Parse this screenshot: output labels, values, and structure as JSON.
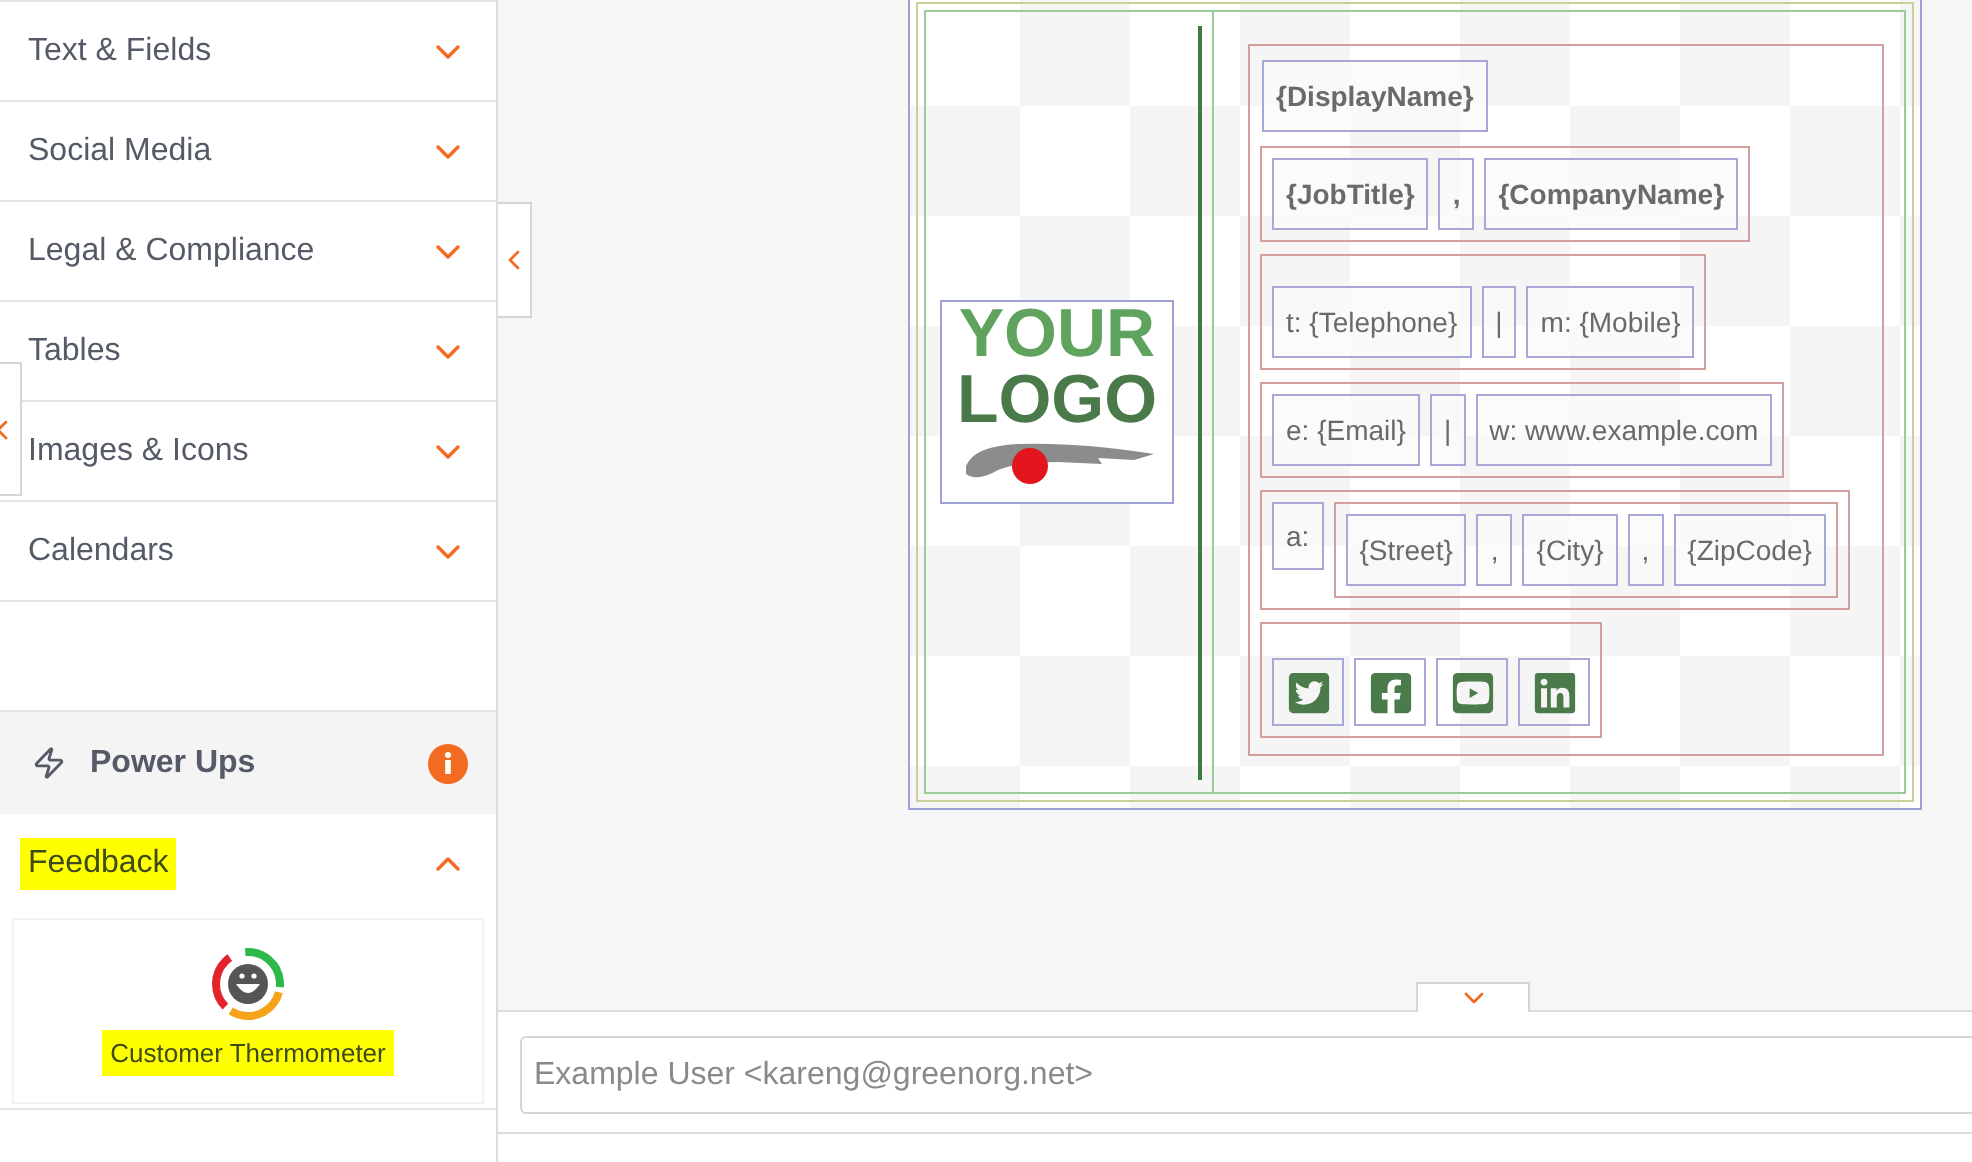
{
  "sidebar": {
    "sections": [
      {
        "label": "Text & Fields",
        "expanded": false
      },
      {
        "label": "Social Media",
        "expanded": false
      },
      {
        "label": "Legal & Compliance",
        "expanded": false
      },
      {
        "label": "Tables",
        "expanded": false
      },
      {
        "label": "Images & Icons",
        "expanded": false
      },
      {
        "label": "Calendars",
        "expanded": false
      }
    ],
    "power_ups": {
      "label": "Power Ups"
    },
    "feedback": {
      "label": "Feedback",
      "expanded": true,
      "highlighted": true,
      "items": [
        {
          "label": "Customer Thermometer",
          "highlighted": true
        }
      ]
    }
  },
  "signature": {
    "logo": {
      "line_1": "YOUR",
      "line_2": "LOGO"
    },
    "rows": [
      {
        "framed": false,
        "cells": [
          {
            "kind": "text",
            "text": "{DisplayName}",
            "bold": true
          }
        ]
      },
      {
        "framed": true,
        "cells": [
          {
            "kind": "text",
            "text": "{JobTitle}",
            "bold": true
          },
          {
            "kind": "text",
            "text": ",",
            "bold": true
          },
          {
            "kind": "text",
            "text": "{CompanyName}",
            "bold": true
          }
        ]
      },
      {
        "framed": true,
        "cells": [
          {
            "kind": "text",
            "text": "t: {Telephone}",
            "bold": false
          },
          {
            "kind": "text",
            "text": "|",
            "bold": false
          },
          {
            "kind": "text",
            "text": "m: {Mobile}",
            "bold": false
          }
        ]
      },
      {
        "framed": true,
        "cells": [
          {
            "kind": "text",
            "text": "e: {Email}",
            "bold": false
          },
          {
            "kind": "text",
            "text": "|",
            "bold": false
          },
          {
            "kind": "text",
            "text": "w: www.example.com",
            "bold": false
          }
        ]
      },
      {
        "framed": true,
        "cells": [
          {
            "kind": "text",
            "text": "a:",
            "bold": false
          },
          {
            "kind": "group",
            "cells": [
              {
                "kind": "text",
                "text": "{Street}",
                "bold": false
              },
              {
                "kind": "text",
                "text": ",",
                "bold": false
              },
              {
                "kind": "text",
                "text": "{City}",
                "bold": false
              },
              {
                "kind": "text",
                "text": ",",
                "bold": false
              },
              {
                "kind": "text",
                "text": "{ZipCode}",
                "bold": false
              }
            ]
          }
        ]
      },
      {
        "framed": true,
        "cells": [
          {
            "kind": "twitter"
          },
          {
            "kind": "facebook"
          },
          {
            "kind": "youtube"
          },
          {
            "kind": "linkedin"
          }
        ]
      }
    ]
  },
  "recipient_field": {
    "value": "Example User <kareng@greenorg.net>"
  }
}
